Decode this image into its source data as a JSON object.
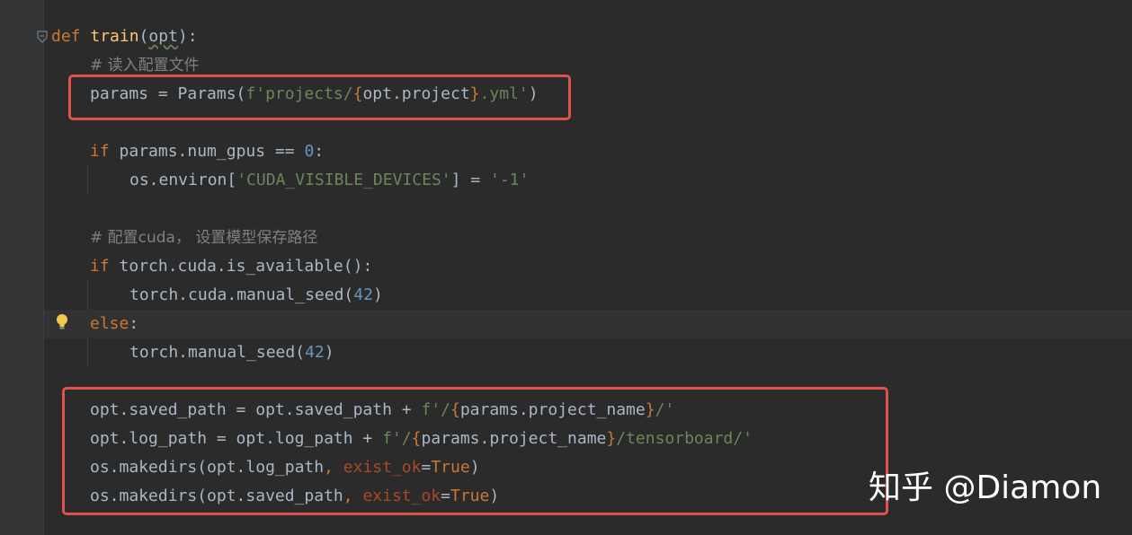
{
  "code": {
    "l1": {
      "def": "def",
      "name": "train",
      "paren_open": "(",
      "param": "opt",
      "paren_close": "):"
    },
    "l2": {
      "comment": "# 读入配置文件"
    },
    "l3": {
      "lhs": "params = Params(",
      "s1": "f'projects/",
      "b1": "{",
      "mid": "opt.project",
      "b2": "}",
      "s2": ".yml'",
      "end": ")"
    },
    "l4": {
      "if": "if",
      "rest": " params.num_gpus == ",
      "num": "0",
      "end": ":"
    },
    "l5": {
      "pre": "os.environ[",
      "str": "'CUDA_VISIBLE_DEVICES'",
      "mid": "] = ",
      "val": "'-1'"
    },
    "l6": {
      "comment": "# 配置cuda， 设置模型保存路径"
    },
    "l7": {
      "if": "if",
      "rest": " torch.cuda.is_available():"
    },
    "l8": {
      "pre": "torch.cuda.manual_seed(",
      "num": "42",
      "end": ")"
    },
    "l9": {
      "else": "else",
      "end": ":"
    },
    "l10": {
      "pre": "torch.manual_seed(",
      "num": "42",
      "end": ")"
    },
    "l11": {
      "pre": "opt.saved_path = opt.saved_path + ",
      "s1": "f'/",
      "b1": "{",
      "mid": "params.project_name",
      "b2": "}",
      "s2": "/'"
    },
    "l12": {
      "pre": "opt.log_path = opt.log_path + ",
      "s1": "f'/",
      "b1": "{",
      "mid": "params.project_name",
      "b2": "}",
      "s2": "/tensorboard/'"
    },
    "l13": {
      "pre": "os.makedirs(opt.log_path",
      "comma": ", ",
      "kw": "exist_ok",
      "eq": "=",
      "val": "True",
      "end": ")"
    },
    "l14": {
      "pre": "os.makedirs(opt.saved_path",
      "comma": ", ",
      "kw": "exist_ok",
      "eq": "=",
      "val": "True",
      "end": ")"
    }
  },
  "watermark": "知乎 @Diamon",
  "colors": {
    "background": "#2b2b2b",
    "keyword": "#cc7832",
    "function": "#ffc66d",
    "string": "#6a8759",
    "number": "#6897bb",
    "comment": "#808080",
    "param": "#aa4926",
    "highlight_box": "#e0524a"
  },
  "icons": [
    "fold-icon",
    "lightbulb-icon"
  ]
}
